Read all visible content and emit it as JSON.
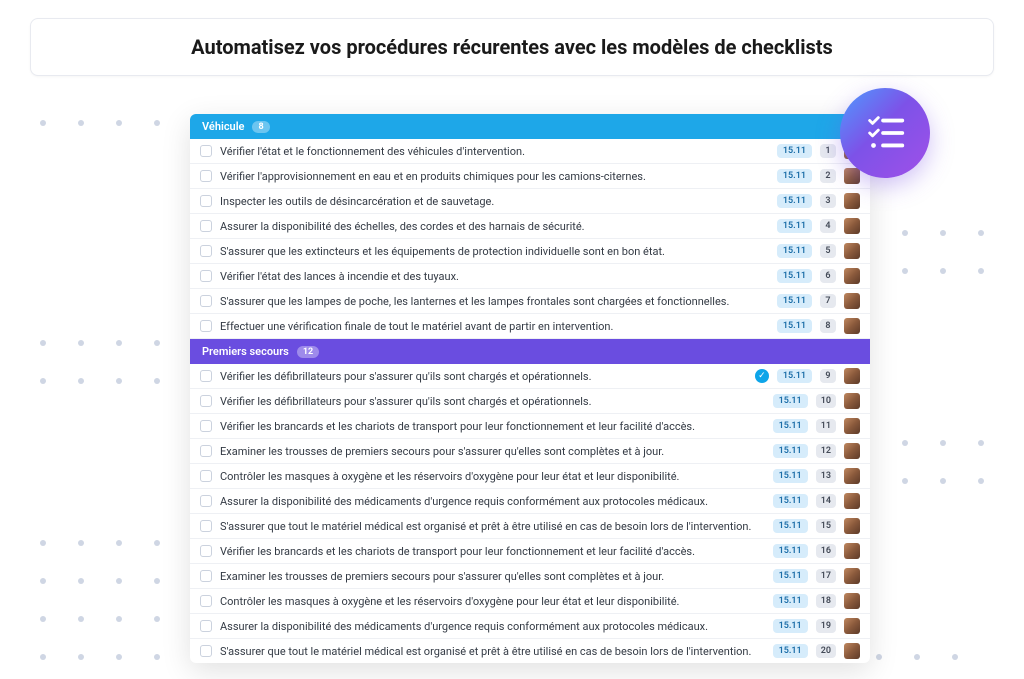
{
  "page_title": "Automatisez vos procédures récurentes avec les modèles de checklists",
  "sections": [
    {
      "title": "Véhicule",
      "count": "8",
      "color": "blue",
      "tasks": [
        {
          "label": "Vérifier l'état et le fonctionnement des véhicules d'intervention.",
          "date": "15.11",
          "num": "1"
        },
        {
          "label": "Vérifier l'approvisionnement en eau et en produits chimiques pour les camions-citernes.",
          "date": "15.11",
          "num": "2"
        },
        {
          "label": "Inspecter les outils de désincarcération et de sauvetage.",
          "date": "15.11",
          "num": "3"
        },
        {
          "label": "Assurer la disponibilité des échelles, des cordes et des harnais de sécurité.",
          "date": "15.11",
          "num": "4"
        },
        {
          "label": "S'assurer que les extincteurs et les équipements de protection individuelle sont en bon état.",
          "date": "15.11",
          "num": "5"
        },
        {
          "label": "Vérifier l'état des lances à incendie et des tuyaux.",
          "date": "15.11",
          "num": "6"
        },
        {
          "label": "S'assurer que les lampes de poche, les lanternes et les lampes frontales sont chargées et fonctionnelles.",
          "date": "15.11",
          "num": "7"
        },
        {
          "label": "Effectuer une vérification finale de tout le matériel avant de partir en intervention.",
          "date": "15.11",
          "num": "8"
        }
      ]
    },
    {
      "title": "Premiers secours",
      "count": "12",
      "color": "purple",
      "tasks": [
        {
          "label": "Vérifier les défibrillateurs pour s'assurer qu'ils sont chargés et opérationnels.",
          "date": "15.11",
          "num": "9",
          "checked": true
        },
        {
          "label": "Vérifier les défibrillateurs pour s'assurer qu'ils sont chargés et opérationnels.",
          "date": "15.11",
          "num": "10"
        },
        {
          "label": "Vérifier les brancards et les chariots de transport pour leur fonctionnement et leur facilité d'accès.",
          "date": "15.11",
          "num": "11"
        },
        {
          "label": "Examiner les trousses de premiers secours pour s'assurer qu'elles sont complètes et à jour.",
          "date": "15.11",
          "num": "12"
        },
        {
          "label": "Contrôler les masques à oxygène et les réservoirs d'oxygène pour leur état et leur disponibilité.",
          "date": "15.11",
          "num": "13"
        },
        {
          "label": "Assurer la disponibilité des médicaments d'urgence requis conformément aux protocoles médicaux.",
          "date": "15.11",
          "num": "14"
        },
        {
          "label": "S'assurer que tout le matériel médical est organisé et prêt à être utilisé en cas de besoin lors de l'intervention.",
          "date": "15.11",
          "num": "15"
        },
        {
          "label": "Vérifier les brancards et les chariots de transport pour leur fonctionnement et leur facilité d'accès.",
          "date": "15.11",
          "num": "16"
        },
        {
          "label": "Examiner les trousses de premiers secours pour s'assurer qu'elles sont complètes et à jour.",
          "date": "15.11",
          "num": "17"
        },
        {
          "label": "Contrôler les masques à oxygène et les réservoirs d'oxygène pour leur état et leur disponibilité.",
          "date": "15.11",
          "num": "18"
        },
        {
          "label": "Assurer la disponibilité des médicaments d'urgence requis conformément aux protocoles médicaux.",
          "date": "15.11",
          "num": "19"
        },
        {
          "label": "S'assurer que tout le matériel médical est organisé et prêt à être utilisé en cas de besoin lors de l'intervention.",
          "date": "15.11",
          "num": "20"
        }
      ]
    }
  ]
}
